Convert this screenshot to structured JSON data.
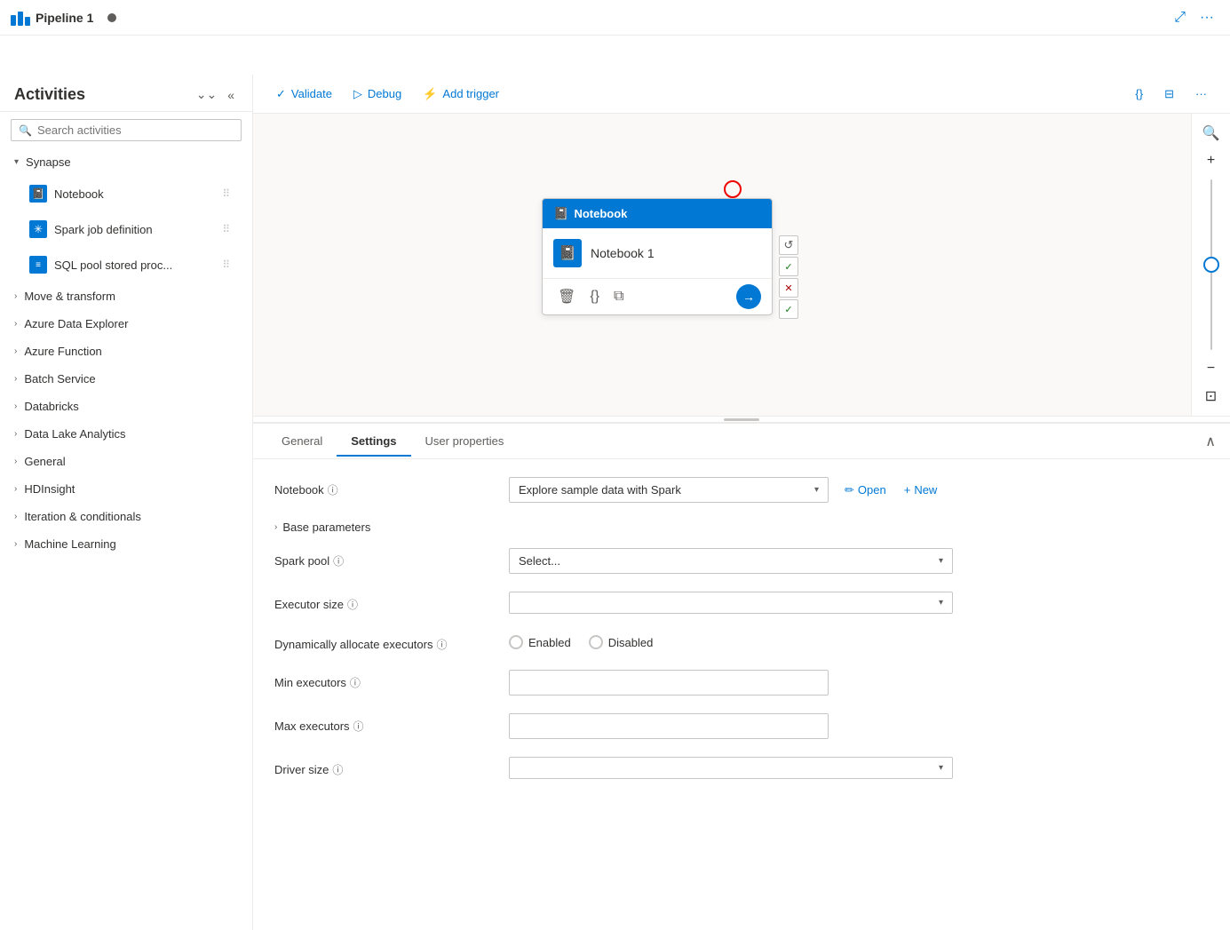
{
  "topbar": {
    "pipeline_name": "Pipeline 1",
    "expand_icon": "⤢",
    "more_icon": "···"
  },
  "toolbar": {
    "validate_label": "Validate",
    "debug_label": "Debug",
    "add_trigger_label": "Add trigger",
    "code_icon": "{}",
    "param_icon": "⊟",
    "more_icon": "···"
  },
  "sidebar": {
    "title": "Activities",
    "search_placeholder": "Search activities",
    "collapse_icon": "⌄⌄",
    "close_icon": "«",
    "categories": [
      {
        "label": "Synapse",
        "expanded": true
      },
      {
        "label": "Move & transform",
        "expanded": false
      },
      {
        "label": "Azure Data Explorer",
        "expanded": false
      },
      {
        "label": "Azure Function",
        "expanded": false
      },
      {
        "label": "Batch Service",
        "expanded": false
      },
      {
        "label": "Databricks",
        "expanded": false
      },
      {
        "label": "Data Lake Analytics",
        "expanded": false
      },
      {
        "label": "General",
        "expanded": false
      },
      {
        "label": "HDInsight",
        "expanded": false
      },
      {
        "label": "Iteration & conditionals",
        "expanded": false
      },
      {
        "label": "Machine Learning",
        "expanded": false
      }
    ],
    "synapse_activities": [
      {
        "label": "Notebook",
        "icon_color": "#0078d4"
      },
      {
        "label": "Spark job definition",
        "icon_color": "#0078d4"
      },
      {
        "label": "SQL pool stored proc...",
        "icon_color": "#0078d4"
      }
    ]
  },
  "canvas": {
    "notebook_card": {
      "header": "Notebook",
      "name": "Notebook 1"
    }
  },
  "bottom_panel": {
    "tabs": [
      {
        "label": "General",
        "active": false
      },
      {
        "label": "Settings",
        "active": true
      },
      {
        "label": "User properties",
        "active": false
      }
    ],
    "settings": {
      "notebook_label": "Notebook",
      "notebook_value": "Explore sample data with Spark",
      "base_parameters_label": "Base parameters",
      "spark_pool_label": "Spark pool",
      "spark_pool_placeholder": "Select...",
      "executor_size_label": "Executor size",
      "executor_size_value": "",
      "dynamic_alloc_label": "Dynamically allocate executors",
      "enabled_label": "Enabled",
      "disabled_label": "Disabled",
      "min_executors_label": "Min executors",
      "max_executors_label": "Max executors",
      "driver_size_label": "Driver size",
      "open_label": "Open",
      "new_label": "New"
    }
  },
  "zoom": {
    "plus": "+",
    "minus": "−"
  }
}
